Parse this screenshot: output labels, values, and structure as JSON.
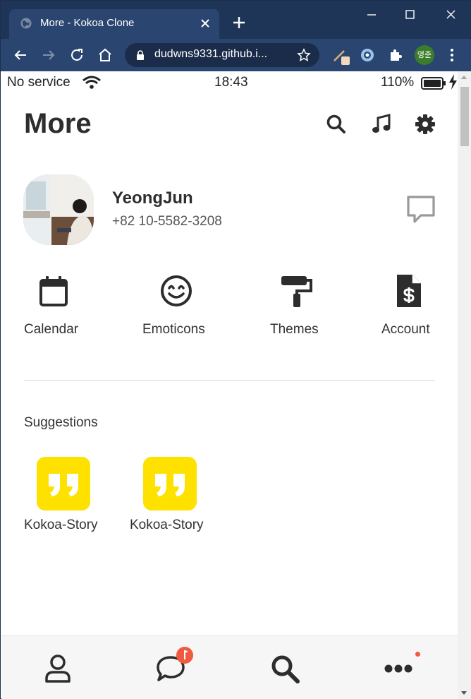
{
  "browser": {
    "tab_title": "More - Kokoa Clone",
    "url": "dudwns9331.github.i...",
    "profile_initials": "영준"
  },
  "status_bar": {
    "carrier": "No service",
    "time": "18:43",
    "battery": "110%"
  },
  "header": {
    "title": "More",
    "icons": [
      "search-icon",
      "music-icon",
      "gear-icon"
    ]
  },
  "profile": {
    "name": "YeongJun",
    "phone": "+82 10-5582-3208"
  },
  "menu": [
    {
      "label": "Calendar",
      "icon": "calendar-icon"
    },
    {
      "label": "Emoticons",
      "icon": "smile-icon"
    },
    {
      "label": "Themes",
      "icon": "paint-roller-icon"
    },
    {
      "label": "Account",
      "icon": "invoice-dollar-icon"
    }
  ],
  "suggestions": {
    "title": "Suggestions",
    "items": [
      {
        "label": "Kokoa-Story",
        "icon": "quote-icon"
      },
      {
        "label": "Kokoa-Story",
        "icon": "quote-icon"
      }
    ]
  },
  "bottom_nav": {
    "items": [
      "user-icon",
      "chat-icon",
      "search-icon",
      "ellipsis-icon"
    ],
    "chat_badge": "!"
  },
  "colors": {
    "chrome_dark": "#1e3557",
    "chrome_toolbar": "#2a4670",
    "text_primary": "#2d2d2d",
    "suggestion_bg": "#ffe100",
    "badge": "#f05a40"
  }
}
